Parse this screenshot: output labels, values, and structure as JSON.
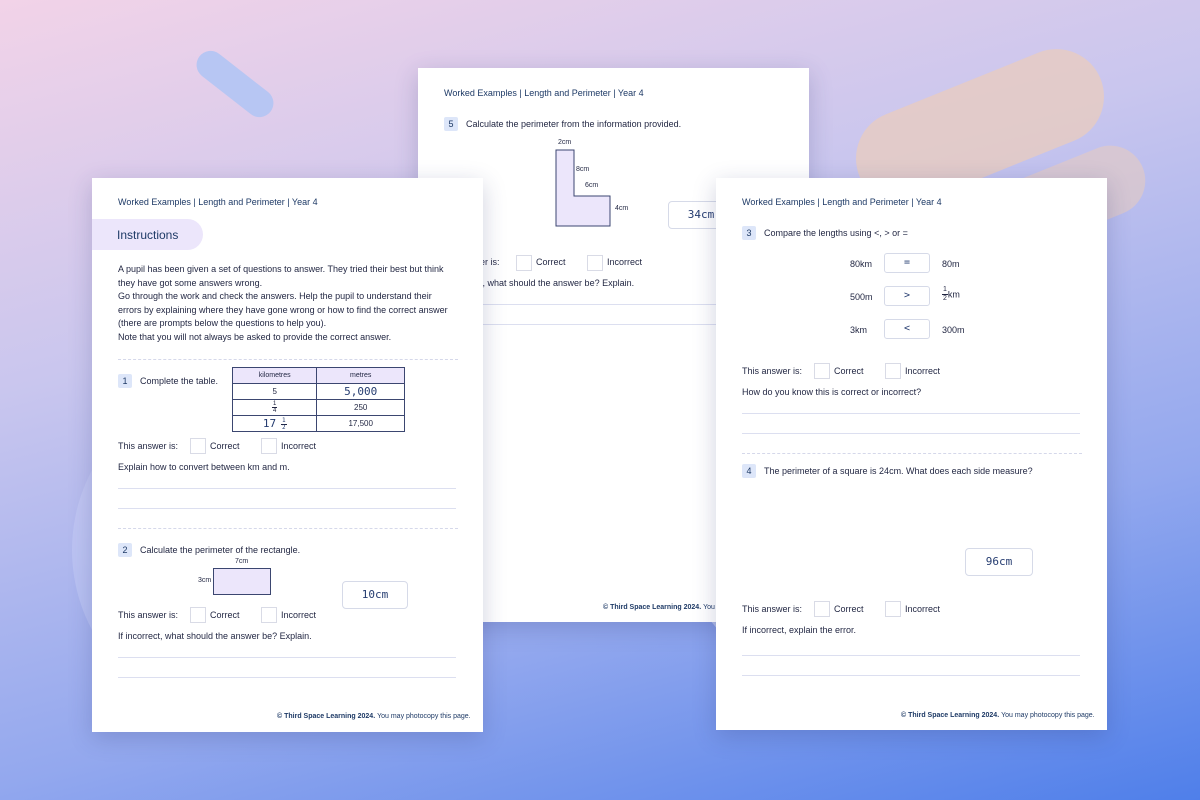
{
  "header_text": "Worked Examples | Length and Perimeter | Year 4",
  "footer": {
    "bold": "© Third Space Learning 2024.",
    "normal": "You may photocopy this page."
  },
  "labels": {
    "this_answer_is": "This answer is:",
    "correct": "Correct",
    "incorrect": "Incorrect"
  },
  "left_sheet": {
    "instructions_title": "Instructions",
    "instructions_lines": [
      "A pupil has been given a set of questions to answer. They tried their best but think",
      "they have got some answers wrong.",
      "Go through the work and check the answers. Help the pupil to understand their",
      "errors by explaining where they have gone wrong or how to find the correct answer",
      "(there are prompts below the questions to help you).",
      "Note that you will not always be asked to provide the correct answer."
    ],
    "q1": {
      "num": "1",
      "text": "Complete the table.",
      "table": {
        "headers": [
          "kilometres",
          "metres"
        ],
        "row1": [
          "5",
          "5,000"
        ],
        "row2_frac": [
          "1",
          "4"
        ],
        "row2_metres": "250",
        "row3_whole": "17",
        "row3_frac": [
          "1",
          "2"
        ],
        "row3_metres": "17,500"
      },
      "prompt": "Explain how to convert between km and m."
    },
    "q2": {
      "num": "2",
      "text": "Calculate the perimeter of the rectangle.",
      "width_label": "7cm",
      "height_label": "3cm",
      "answer": "10cm",
      "prompt": "If incorrect, what should the answer be? Explain."
    }
  },
  "middle_sheet": {
    "q5": {
      "num": "5",
      "text": "Calculate the perimeter from the information provided.",
      "labels": {
        "top": "2cm",
        "inner_vertical": "8cm",
        "inner_horizontal": "6cm",
        "right": "4cm"
      },
      "answer": "34cm",
      "answer_prefix": "er is:",
      "prompt_fragment": "t, what should the answer be? Explain."
    },
    "footer_fragment_bold": "© Third Space Learning 2024.",
    "footer_fragment_normal": "You r"
  },
  "right_sheet": {
    "q3": {
      "num": "3",
      "text": "Compare the lengths using <, > or =",
      "row1": {
        "left": "80km",
        "symbol": "=",
        "right": "80m"
      },
      "row2": {
        "left": "500m",
        "symbol": ">",
        "right_frac": [
          "1",
          "2"
        ],
        "right_unit": "km"
      },
      "row3": {
        "left": "3km",
        "symbol": "<",
        "right": "300m"
      },
      "prompt": "How do you know this is correct or incorrect?"
    },
    "q4": {
      "num": "4",
      "text": "The perimeter of a square is 24cm. What does each side measure?",
      "answer": "96cm",
      "prompt": "If incorrect, explain the error."
    }
  }
}
